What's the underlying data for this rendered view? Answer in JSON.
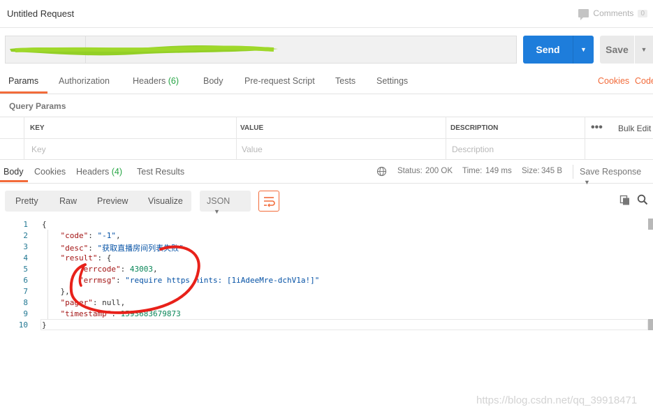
{
  "window": {
    "title": "Untitled Request"
  },
  "comments": {
    "label": "Comments",
    "count": "0"
  },
  "request": {
    "send_label": "Send",
    "save_label": "Save",
    "tabs": [
      {
        "label": "Params"
      },
      {
        "label": "Authorization"
      },
      {
        "label": "Headers",
        "count": "(6)"
      },
      {
        "label": "Body"
      },
      {
        "label": "Pre-request Script"
      },
      {
        "label": "Tests"
      },
      {
        "label": "Settings"
      }
    ],
    "cookies_link": "Cookies",
    "code_link": "Code"
  },
  "query_params": {
    "title": "Query Params",
    "columns": {
      "key": "KEY",
      "value": "VALUE",
      "description": "DESCRIPTION"
    },
    "placeholders": {
      "key": "Key",
      "value": "Value",
      "description": "Description"
    },
    "bulk_edit": "Bulk Edit"
  },
  "response": {
    "tabs": [
      {
        "label": "Body"
      },
      {
        "label": "Cookies"
      },
      {
        "label": "Headers",
        "count": "(4)"
      },
      {
        "label": "Test Results"
      }
    ],
    "status_label": "Status:",
    "status_value": "200 OK",
    "time_label": "Time:",
    "time_value": "149 ms",
    "size_label": "Size:",
    "size_value": "345 B",
    "save_response": "Save Response",
    "view_modes": [
      "Pretty",
      "Raw",
      "Preview",
      "Visualize"
    ],
    "format": "JSON"
  },
  "code": {
    "line_numbers": [
      "1",
      "2",
      "3",
      "4",
      "5",
      "6",
      "7",
      "8",
      "9",
      "10"
    ],
    "lines": [
      {
        "p1": "{",
        "k": "",
        "m": "",
        "v": "",
        "t": ""
      },
      {
        "p1": "    ",
        "k": "\"code\"",
        "m": ": ",
        "v": "\"-1\"",
        "t": ",",
        "vtype": "s"
      },
      {
        "p1": "    ",
        "k": "\"desc\"",
        "m": ": ",
        "v": "\"获取直播房间列表失败\"",
        "t": "",
        "vtype": "s"
      },
      {
        "p1": "    ",
        "k": "\"result\"",
        "m": ": {",
        "v": "",
        "t": ""
      },
      {
        "p1": "        ",
        "k": "\"errcode\"",
        "m": ": ",
        "v": "43003",
        "t": ",",
        "vtype": "n"
      },
      {
        "p1": "        ",
        "k": "\"errmsg\"",
        "m": ": ",
        "v": "\"require https hints: [1iAdeeMre-dchV1a!]\"",
        "t": "",
        "vtype": "s"
      },
      {
        "p1": "    },",
        "k": "",
        "m": "",
        "v": "",
        "t": ""
      },
      {
        "p1": "    ",
        "k": "\"pager\"",
        "m": ": null,",
        "v": "",
        "t": ""
      },
      {
        "p1": "    ",
        "k": "\"timestamp\"",
        "m": ": ",
        "v": "1593683679873",
        "t": "",
        "vtype": "n"
      },
      {
        "p1": "}",
        "k": "",
        "m": "",
        "v": "",
        "t": ""
      }
    ]
  },
  "watermark": "https://blog.csdn.net/qq_39918471",
  "colors": {
    "accent": "#f26b3a",
    "send": "#1e7ddb",
    "success": "#26a544",
    "scribble": "#8dcc1a",
    "annotation": "#e8211a"
  }
}
